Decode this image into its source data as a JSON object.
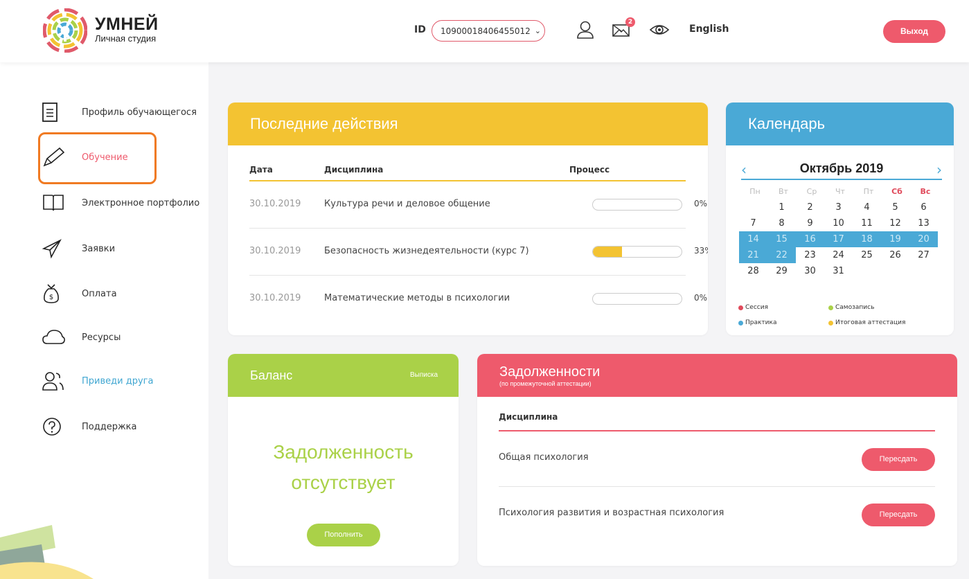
{
  "header": {
    "brand_name": "УМНЕЙ",
    "brand_sub": "Личная студия",
    "id_label": "ID",
    "id_value": "10900018406455012",
    "mail_badge": "2",
    "language": "English",
    "logout": "Выход"
  },
  "sidebar": {
    "items": [
      {
        "label": "Профиль обучающегося",
        "icon": "document-icon"
      },
      {
        "label": "Обучение",
        "icon": "pencil-icon"
      },
      {
        "label": "Электронное портфолио",
        "icon": "book-icon"
      },
      {
        "label": "Заявки",
        "icon": "paper-plane-icon"
      },
      {
        "label": "Оплата",
        "icon": "money-bag-icon"
      },
      {
        "label": "Ресурсы",
        "icon": "cloud-icon"
      },
      {
        "label": "Приведи друга",
        "icon": "users-icon"
      },
      {
        "label": "Поддержка",
        "icon": "question-icon"
      }
    ]
  },
  "recent": {
    "title": "Последние действия",
    "col_date": "Дата",
    "col_subject": "Дисциплина",
    "col_process": "Процесс",
    "rows": [
      {
        "date": "30.10.2019",
        "subject": "Культура речи и деловое общение",
        "progress": 0,
        "percent": "0%"
      },
      {
        "date": "30.10.2019",
        "subject": "Безопасность жизнедеятельности (курс 7)",
        "progress": 33,
        "percent": "33%"
      },
      {
        "date": "30.10.2019",
        "subject": "Математические методы в психологии",
        "progress": 0,
        "percent": "0%"
      }
    ]
  },
  "calendar": {
    "title": "Календарь",
    "month": "Октябрь 2019",
    "prev": "‹",
    "next": "›",
    "weekdays": [
      "Пн",
      "Вт",
      "Ср",
      "Чт",
      "Пт",
      "Сб",
      "Вс"
    ],
    "days": [
      [
        "",
        "1",
        "2",
        "3",
        "4",
        "5",
        "6"
      ],
      [
        "7",
        "8",
        "9",
        "10",
        "11",
        "12",
        "13"
      ],
      [
        "14",
        "15",
        "16",
        "17",
        "18",
        "19",
        "20"
      ],
      [
        "21",
        "22",
        "23",
        "24",
        "25",
        "26",
        "27"
      ],
      [
        "28",
        "29",
        "30",
        "31",
        "",
        "",
        ""
      ]
    ],
    "highlighted": [
      "14",
      "15",
      "16",
      "17",
      "18",
      "19",
      "20",
      "21",
      "22"
    ],
    "legend": [
      {
        "label": "Сессия",
        "color": "#e04a5b"
      },
      {
        "label": "Самозапись",
        "color": "#aad148"
      },
      {
        "label": "Практика",
        "color": "#4aa9d6"
      },
      {
        "label": "Итоговая аттестация",
        "color": "#f3c332"
      }
    ]
  },
  "balance": {
    "title": "Баланс",
    "statement": "Выписка",
    "line1": "Задолженность",
    "line2": "отсутствует",
    "topup": "Пополнить"
  },
  "debts": {
    "title": "Задолженности",
    "subtitle": "(по промежуточной аттестации)",
    "col_subject": "Дисциплина",
    "rows": [
      {
        "subject": "Общая психология",
        "action": "Пересдать"
      },
      {
        "subject": "Психология развития и возрастная психология",
        "action": "Пересдать"
      }
    ]
  },
  "colors": {
    "yellow": "#f3c332",
    "blue": "#4aa9d6",
    "green": "#aad148",
    "red": "#ee5a6c",
    "highlight_orange": "#f07a22"
  }
}
